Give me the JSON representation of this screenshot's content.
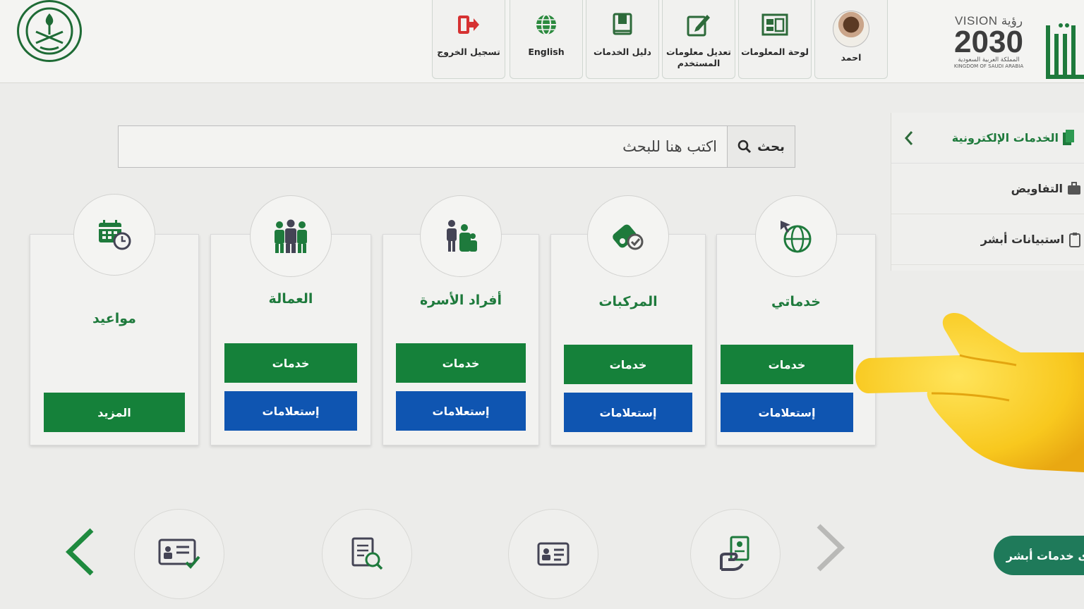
{
  "header": {
    "logout_label": "تسجيل الخروج",
    "language_label": "English",
    "guide_label": "دليل الخدمات",
    "edit_info_label": "تعديل معلومات المستخدم",
    "dashboard_label": "لوحة المعلومات",
    "user_name": "احمد",
    "vision_word": "VISION",
    "vision_arabic": "رؤية",
    "vision_year": "2030",
    "kingdom_ar": "المملكة العربية السعودية",
    "kingdom_en": "KINGDOM OF SAUDI ARABIA"
  },
  "sidebar": {
    "title": "الخدمات الإلكترونية",
    "items": [
      {
        "label": "التفاويض",
        "icon": "briefcase-icon"
      },
      {
        "label": "استبيانات أبشر",
        "icon": "clipboard-icon"
      }
    ]
  },
  "search": {
    "placeholder": "اكتب هنا للبحث",
    "button_label": "بحث"
  },
  "cards": [
    {
      "title": "خدماتي",
      "icon": "globe-cursor-icon",
      "services_label": "خدمات",
      "inquiries_label": "إستعلامات"
    },
    {
      "title": "المركبات",
      "icon": "car-key-icon",
      "services_label": "خدمات",
      "inquiries_label": "إستعلامات"
    },
    {
      "title": "أفراد الأسرة",
      "icon": "family-icon",
      "services_label": "خدمات",
      "inquiries_label": "إستعلامات"
    },
    {
      "title": "العمالة",
      "icon": "workers-icon",
      "services_label": "خدمات",
      "inquiries_label": "إستعلامات"
    },
    {
      "title": "مواعيد",
      "icon": "calendar-clock-icon",
      "more_label": "المزيد"
    }
  ],
  "bottom": {
    "pill_label": "ى خدمات أبشر"
  },
  "colors": {
    "green": "#15813a",
    "blue": "#0f55b1",
    "title_green": "#1e7a3c"
  }
}
